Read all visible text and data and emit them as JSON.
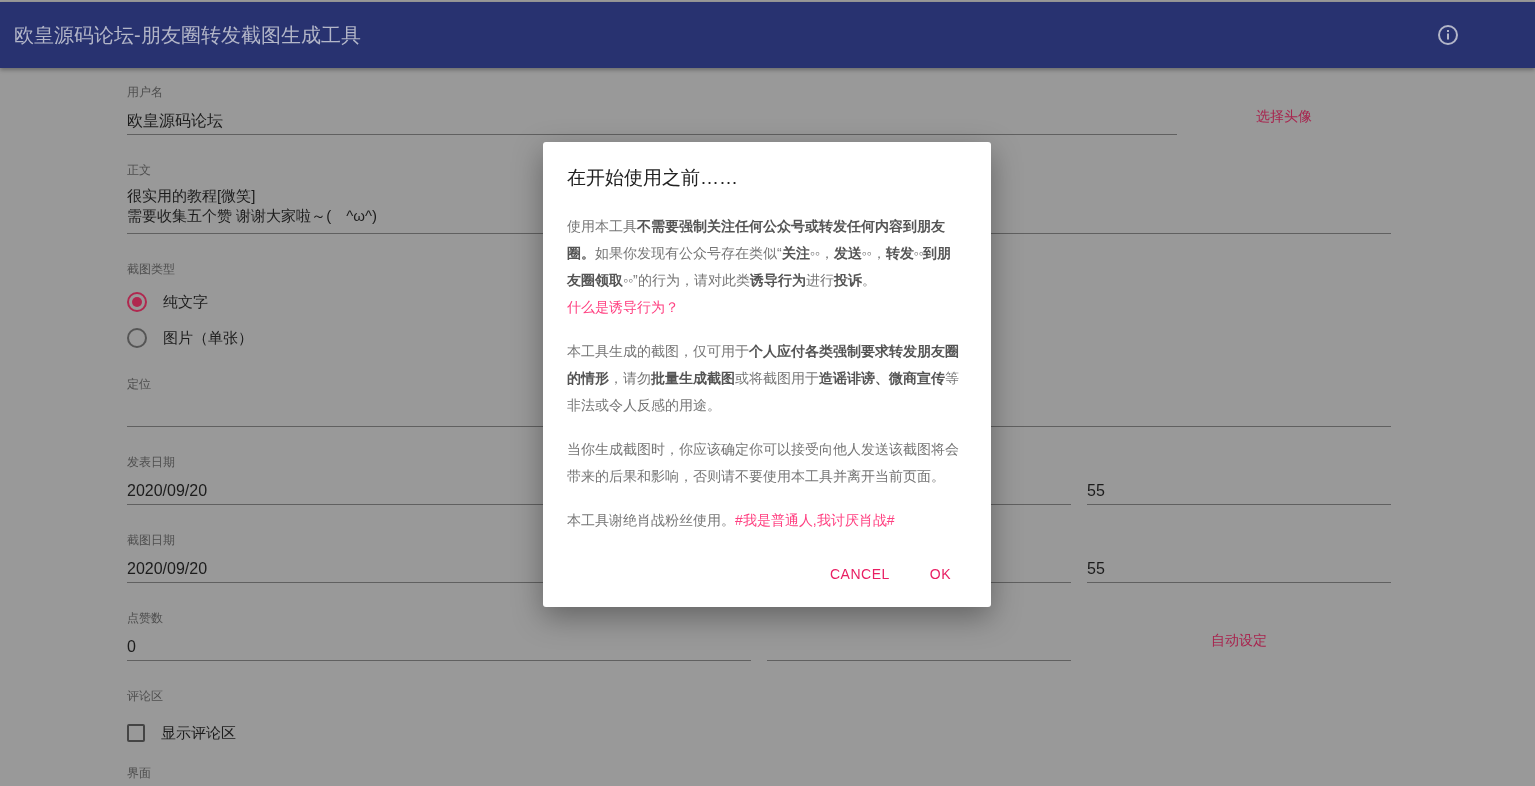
{
  "app_bar": {
    "title": "欧皇源码论坛-朋友圈转发截图生成工具"
  },
  "form": {
    "username": {
      "label": "用户名",
      "value": "欧皇源码论坛",
      "action": "选择头像"
    },
    "body": {
      "label": "正文",
      "lines": [
        "很实用的教程[微笑]",
        "需要收集五个赞 谢谢大家啦～(　^ω^)"
      ]
    },
    "screenshot_type": {
      "label": "截图类型",
      "options": [
        {
          "label": "纯文字",
          "selected": true
        },
        {
          "label": "图片（单张）",
          "selected": false
        }
      ]
    },
    "location": {
      "label": "定位"
    },
    "post_date": {
      "label": "发表日期",
      "value": "2020/09/20",
      "column_3": "55"
    },
    "capture_date": {
      "label": "截图日期",
      "value": "2020/09/20",
      "column_3": "55"
    },
    "likes": {
      "label": "点赞数",
      "value": "0",
      "action": "自动设定"
    },
    "comments": {
      "label": "评论区",
      "checkbox": {
        "label": "显示评论区",
        "checked": false
      }
    },
    "interface": {
      "label": "界面"
    }
  },
  "dialog": {
    "title": "在开始使用之前……",
    "paragraphs": [
      {
        "text": "使用本工具**不需要强制关注任何公众号或转发任何内容到朋友圈。**如果你发现有公众号存在类似“**关注**◦◦，**发送**◦◦，**转发**◦◦**到朋友圈领取**◦◦”的行为，请对此类**诱导行为**进行**投诉**。",
        "link": "什么是诱导行为？"
      },
      {
        "text": "本工具生成的截图，仅可用于**个人应付各类强制要求转发朋友圈的情形**，请勿**批量生成截图**或将截图用于**造谣诽谤、微商宣传**等非法或令人反感的用途。"
      },
      {
        "text": "当你生成截图时，你应该确定你可以接受向他人发送该截图将会带来的后果和影响，否则请不要使用本工具并离开当前页面。"
      },
      {
        "text": "本工具谢绝肖战粉丝使用。",
        "link": "#我是普通人,我讨厌肖战#"
      }
    ],
    "buttons": [
      "CANCEL",
      "OK"
    ]
  }
}
